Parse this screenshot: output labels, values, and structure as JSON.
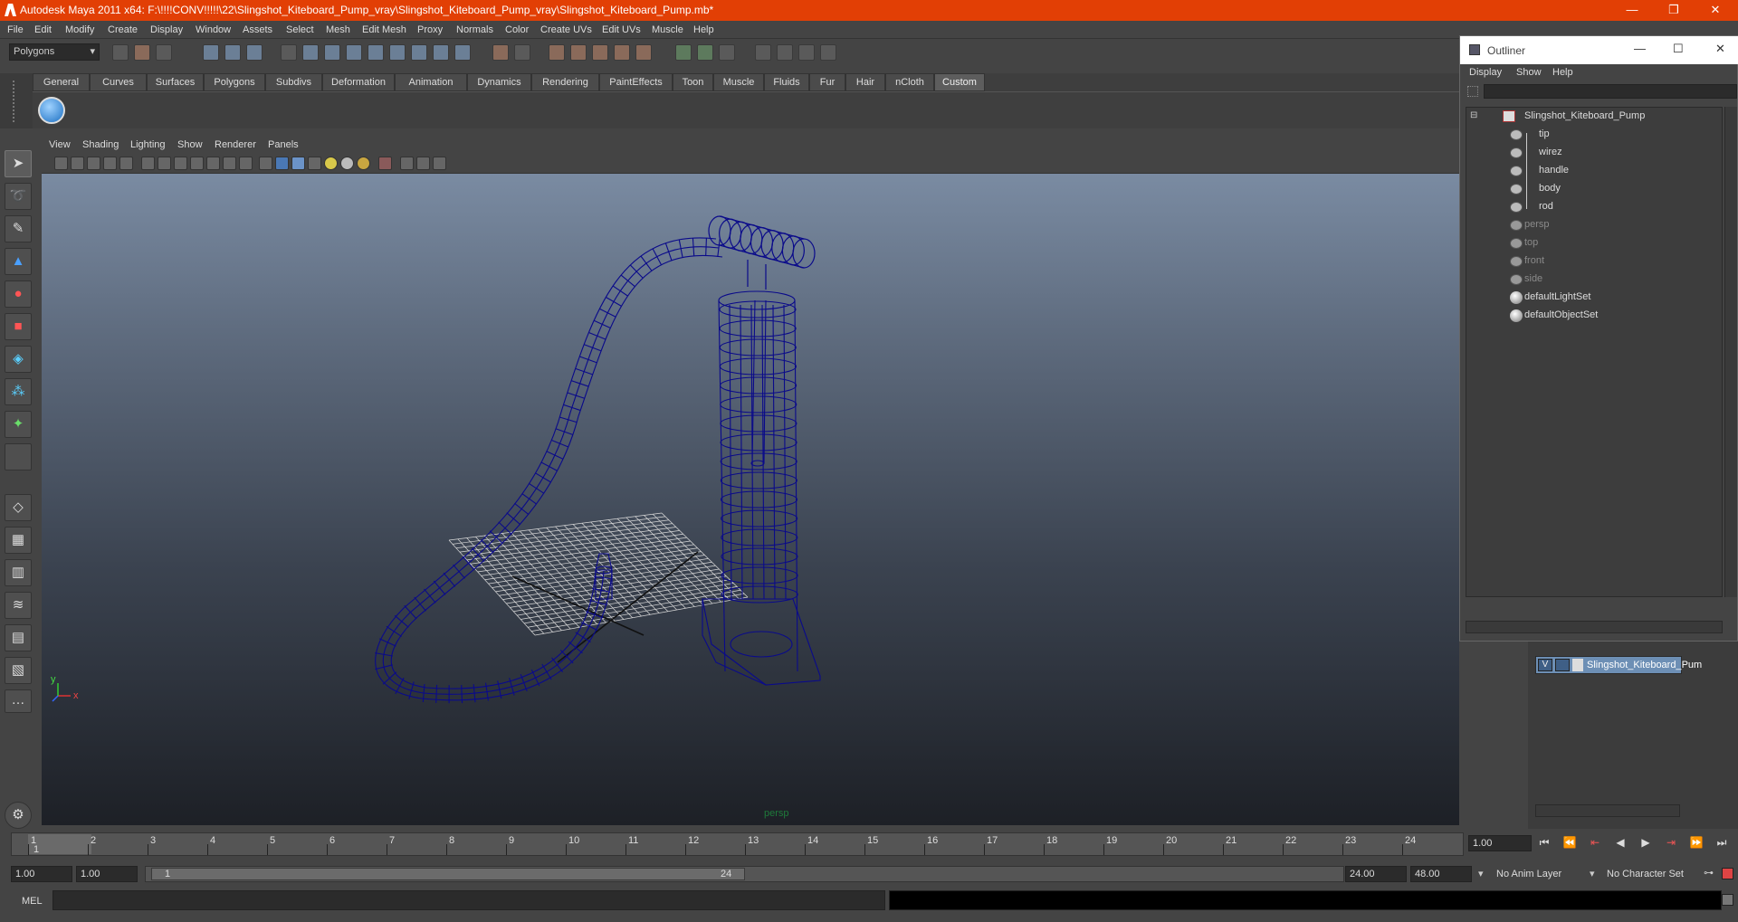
{
  "window": {
    "title": "Autodesk Maya 2011 x64: F:\\!!!!CONV!!!!!\\22\\Slingshot_Kiteboard_Pump_vray\\Slingshot_Kiteboard_Pump_vray\\Slingshot_Kiteboard_Pump.mb*",
    "minimize": "—",
    "restore": "❐",
    "close": "✕"
  },
  "menubar": [
    "File",
    "Edit",
    "Modify",
    "Create",
    "Display",
    "Window",
    "Assets",
    "Select",
    "Mesh",
    "Edit Mesh",
    "Proxy",
    "Normals",
    "Color",
    "Create UVs",
    "Edit UVs",
    "Muscle",
    "Help"
  ],
  "mode_selector": "Polygons",
  "shelf_tabs": [
    "General",
    "Curves",
    "Surfaces",
    "Polygons",
    "Subdivs",
    "Deformation",
    "Animation",
    "Dynamics",
    "Rendering",
    "PaintEffects",
    "Toon",
    "Muscle",
    "Fluids",
    "Fur",
    "Hair",
    "nCloth",
    "Custom"
  ],
  "active_shelf": "Custom",
  "panel_menu": [
    "View",
    "Shading",
    "Lighting",
    "Show",
    "Renderer",
    "Panels"
  ],
  "viewport": {
    "camera_label": "persp",
    "axis_x": "x",
    "axis_y": "y",
    "wire_color": "#0a0a8a"
  },
  "outliner": {
    "title": "Outliner",
    "menu": [
      "Display",
      "Show",
      "Help"
    ],
    "items": [
      {
        "label": "Slingshot_Kiteboard_Pump",
        "type": "group",
        "dim": false
      },
      {
        "label": "tip",
        "type": "mesh",
        "dim": false
      },
      {
        "label": "wirez",
        "type": "mesh",
        "dim": false
      },
      {
        "label": "handle",
        "type": "mesh",
        "dim": false
      },
      {
        "label": "body",
        "type": "mesh",
        "dim": false
      },
      {
        "label": "rod",
        "type": "mesh",
        "dim": false
      },
      {
        "label": "persp",
        "type": "camera",
        "dim": true
      },
      {
        "label": "top",
        "type": "camera",
        "dim": true
      },
      {
        "label": "front",
        "type": "camera",
        "dim": true
      },
      {
        "label": "side",
        "type": "camera",
        "dim": true
      },
      {
        "label": "defaultLightSet",
        "type": "set",
        "dim": false
      },
      {
        "label": "defaultObjectSet",
        "type": "set",
        "dim": false
      }
    ]
  },
  "layer": {
    "visibility": "V",
    "name": "Slingshot_Kiteboard_Pum"
  },
  "timeline": {
    "ticks": [
      "1",
      "2",
      "3",
      "4",
      "5",
      "6",
      "7",
      "8",
      "9",
      "10",
      "11",
      "12",
      "13",
      "14",
      "15",
      "16",
      "17",
      "18",
      "19",
      "20",
      "21",
      "22",
      "23",
      "24"
    ],
    "current_frame_marker": "1",
    "current_time": "1.00"
  },
  "range": {
    "start_time": "1.00",
    "playback_start": "1.00",
    "slider_start": "1",
    "slider_end": "24",
    "playback_end": "24.00",
    "end_time": "48.00",
    "anim_layer": "No Anim Layer",
    "character_set": "No Character Set"
  },
  "playback_buttons": [
    "⏮",
    "⏪",
    "⇤",
    "◀",
    "▶",
    "⇥",
    "⏩",
    "⏭"
  ],
  "command_line": {
    "label": "MEL"
  }
}
